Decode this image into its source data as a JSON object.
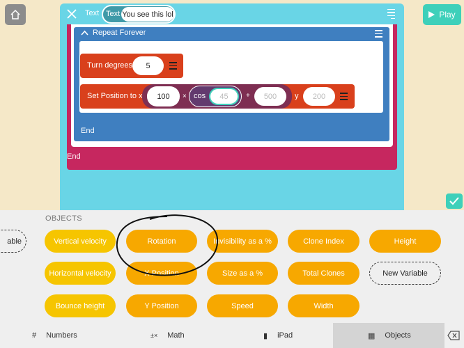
{
  "toolbar": {
    "play_label": "Play"
  },
  "editor": {
    "header_text": "Text",
    "pill_label": "Text",
    "pill_value": "You see this lol"
  },
  "script": {
    "repeat_label": "Repeat Forever",
    "repeat_end": "End",
    "outer_end": "End",
    "turn": {
      "label": "Turn degrees",
      "value": "5"
    },
    "set_position": {
      "label": "Set Position to x",
      "factor": "100",
      "times": "×",
      "cos_label": "cos",
      "cos_value": "45",
      "plus": "+",
      "offset": "500",
      "y_label": "y",
      "y_value": "200"
    }
  },
  "palette": {
    "section_label": "OBJECTS",
    "partial_chip": "able",
    "chips": [
      "Vertical velocity",
      "Rotation",
      "Invisibility as a %",
      "Clone Index",
      "Height",
      "Horizontal velocity",
      "X Position",
      "Size as a %",
      "Total Clones",
      "New Variable",
      "Bounce height",
      "Y Position",
      "Speed",
      "Width"
    ]
  },
  "tabs": [
    {
      "icon": "#",
      "label": "Numbers"
    },
    {
      "icon": "±×",
      "label": "Math"
    },
    {
      "icon": "▮",
      "label": "iPad"
    },
    {
      "icon": "▦",
      "label": "Objects"
    }
  ],
  "colors": {
    "teal": "#69d5e6",
    "pink": "#c6275f",
    "blue": "#3f7fc0",
    "red": "#d9401c",
    "orange": "#f7a800",
    "yellow": "#f6c500",
    "accent": "#3ed0ba"
  }
}
